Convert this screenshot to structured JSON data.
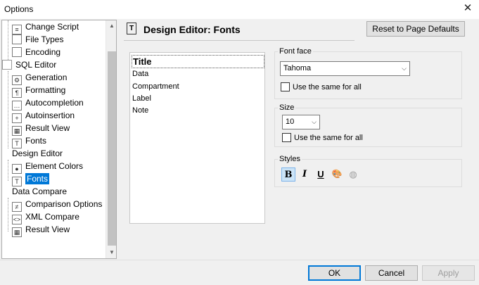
{
  "window": {
    "title": "Options",
    "close_glyph": "✕"
  },
  "tree": {
    "items": [
      {
        "label": "Change Script",
        "icon": "script-icon",
        "glyph": "≡"
      },
      {
        "label": "File Types",
        "icon": "file-icon",
        "glyph": ""
      },
      {
        "label": "Encoding",
        "icon": "encoding-icon",
        "glyph": ""
      },
      {
        "label": "SQL Editor",
        "icon": "sql-icon",
        "glyph": ""
      },
      {
        "label": "Generation",
        "icon": "generation-icon",
        "glyph": "⚙"
      },
      {
        "label": "Formatting",
        "icon": "formatting-icon",
        "glyph": "¶"
      },
      {
        "label": "Autocompletion",
        "icon": "autocompletion-icon",
        "glyph": "…"
      },
      {
        "label": "Autoinsertion",
        "icon": "autoinsertion-icon",
        "glyph": "+"
      },
      {
        "label": "Result View",
        "icon": "grid-icon",
        "glyph": "▦"
      },
      {
        "label": "Fonts",
        "icon": "font-icon",
        "glyph": "T"
      },
      {
        "label": "Design Editor",
        "icon": "",
        "glyph": ""
      },
      {
        "label": "Element Colors",
        "icon": "palette-icon",
        "glyph": "●"
      },
      {
        "label": "Fonts",
        "icon": "font-icon",
        "glyph": "T"
      },
      {
        "label": "Data Compare",
        "icon": "",
        "glyph": ""
      },
      {
        "label": "Comparison Options",
        "icon": "compare-icon",
        "glyph": "≠"
      },
      {
        "label": "XML Compare",
        "icon": "xml-icon",
        "glyph": "<>"
      },
      {
        "label": "Result View",
        "icon": "grid-icon",
        "glyph": "▦"
      }
    ],
    "scroll_up": "▲",
    "scroll_down": "▼"
  },
  "panel": {
    "title": "Design Editor: Fonts",
    "title_icon_glyph": "T",
    "reset_button": "Reset to Page Defaults"
  },
  "elements": [
    "Title",
    "Data",
    "Compartment",
    "Label",
    "Note"
  ],
  "font_face": {
    "group_label": "Font face",
    "value": "Tahoma",
    "same_for_all": "Use the same for all",
    "chevron": "⌵"
  },
  "size": {
    "group_label": "Size",
    "value": "10",
    "same_for_all": "Use the same for all",
    "chevron": "⌵"
  },
  "styles": {
    "group_label": "Styles",
    "bold": "B",
    "italic": "I",
    "underline": "U",
    "color": "🎨",
    "background": "◍"
  },
  "footer": {
    "ok": "OK",
    "cancel": "Cancel",
    "apply": "Apply"
  },
  "colors": {
    "selection": "#0078d7",
    "accent_border": "#0078d7"
  }
}
